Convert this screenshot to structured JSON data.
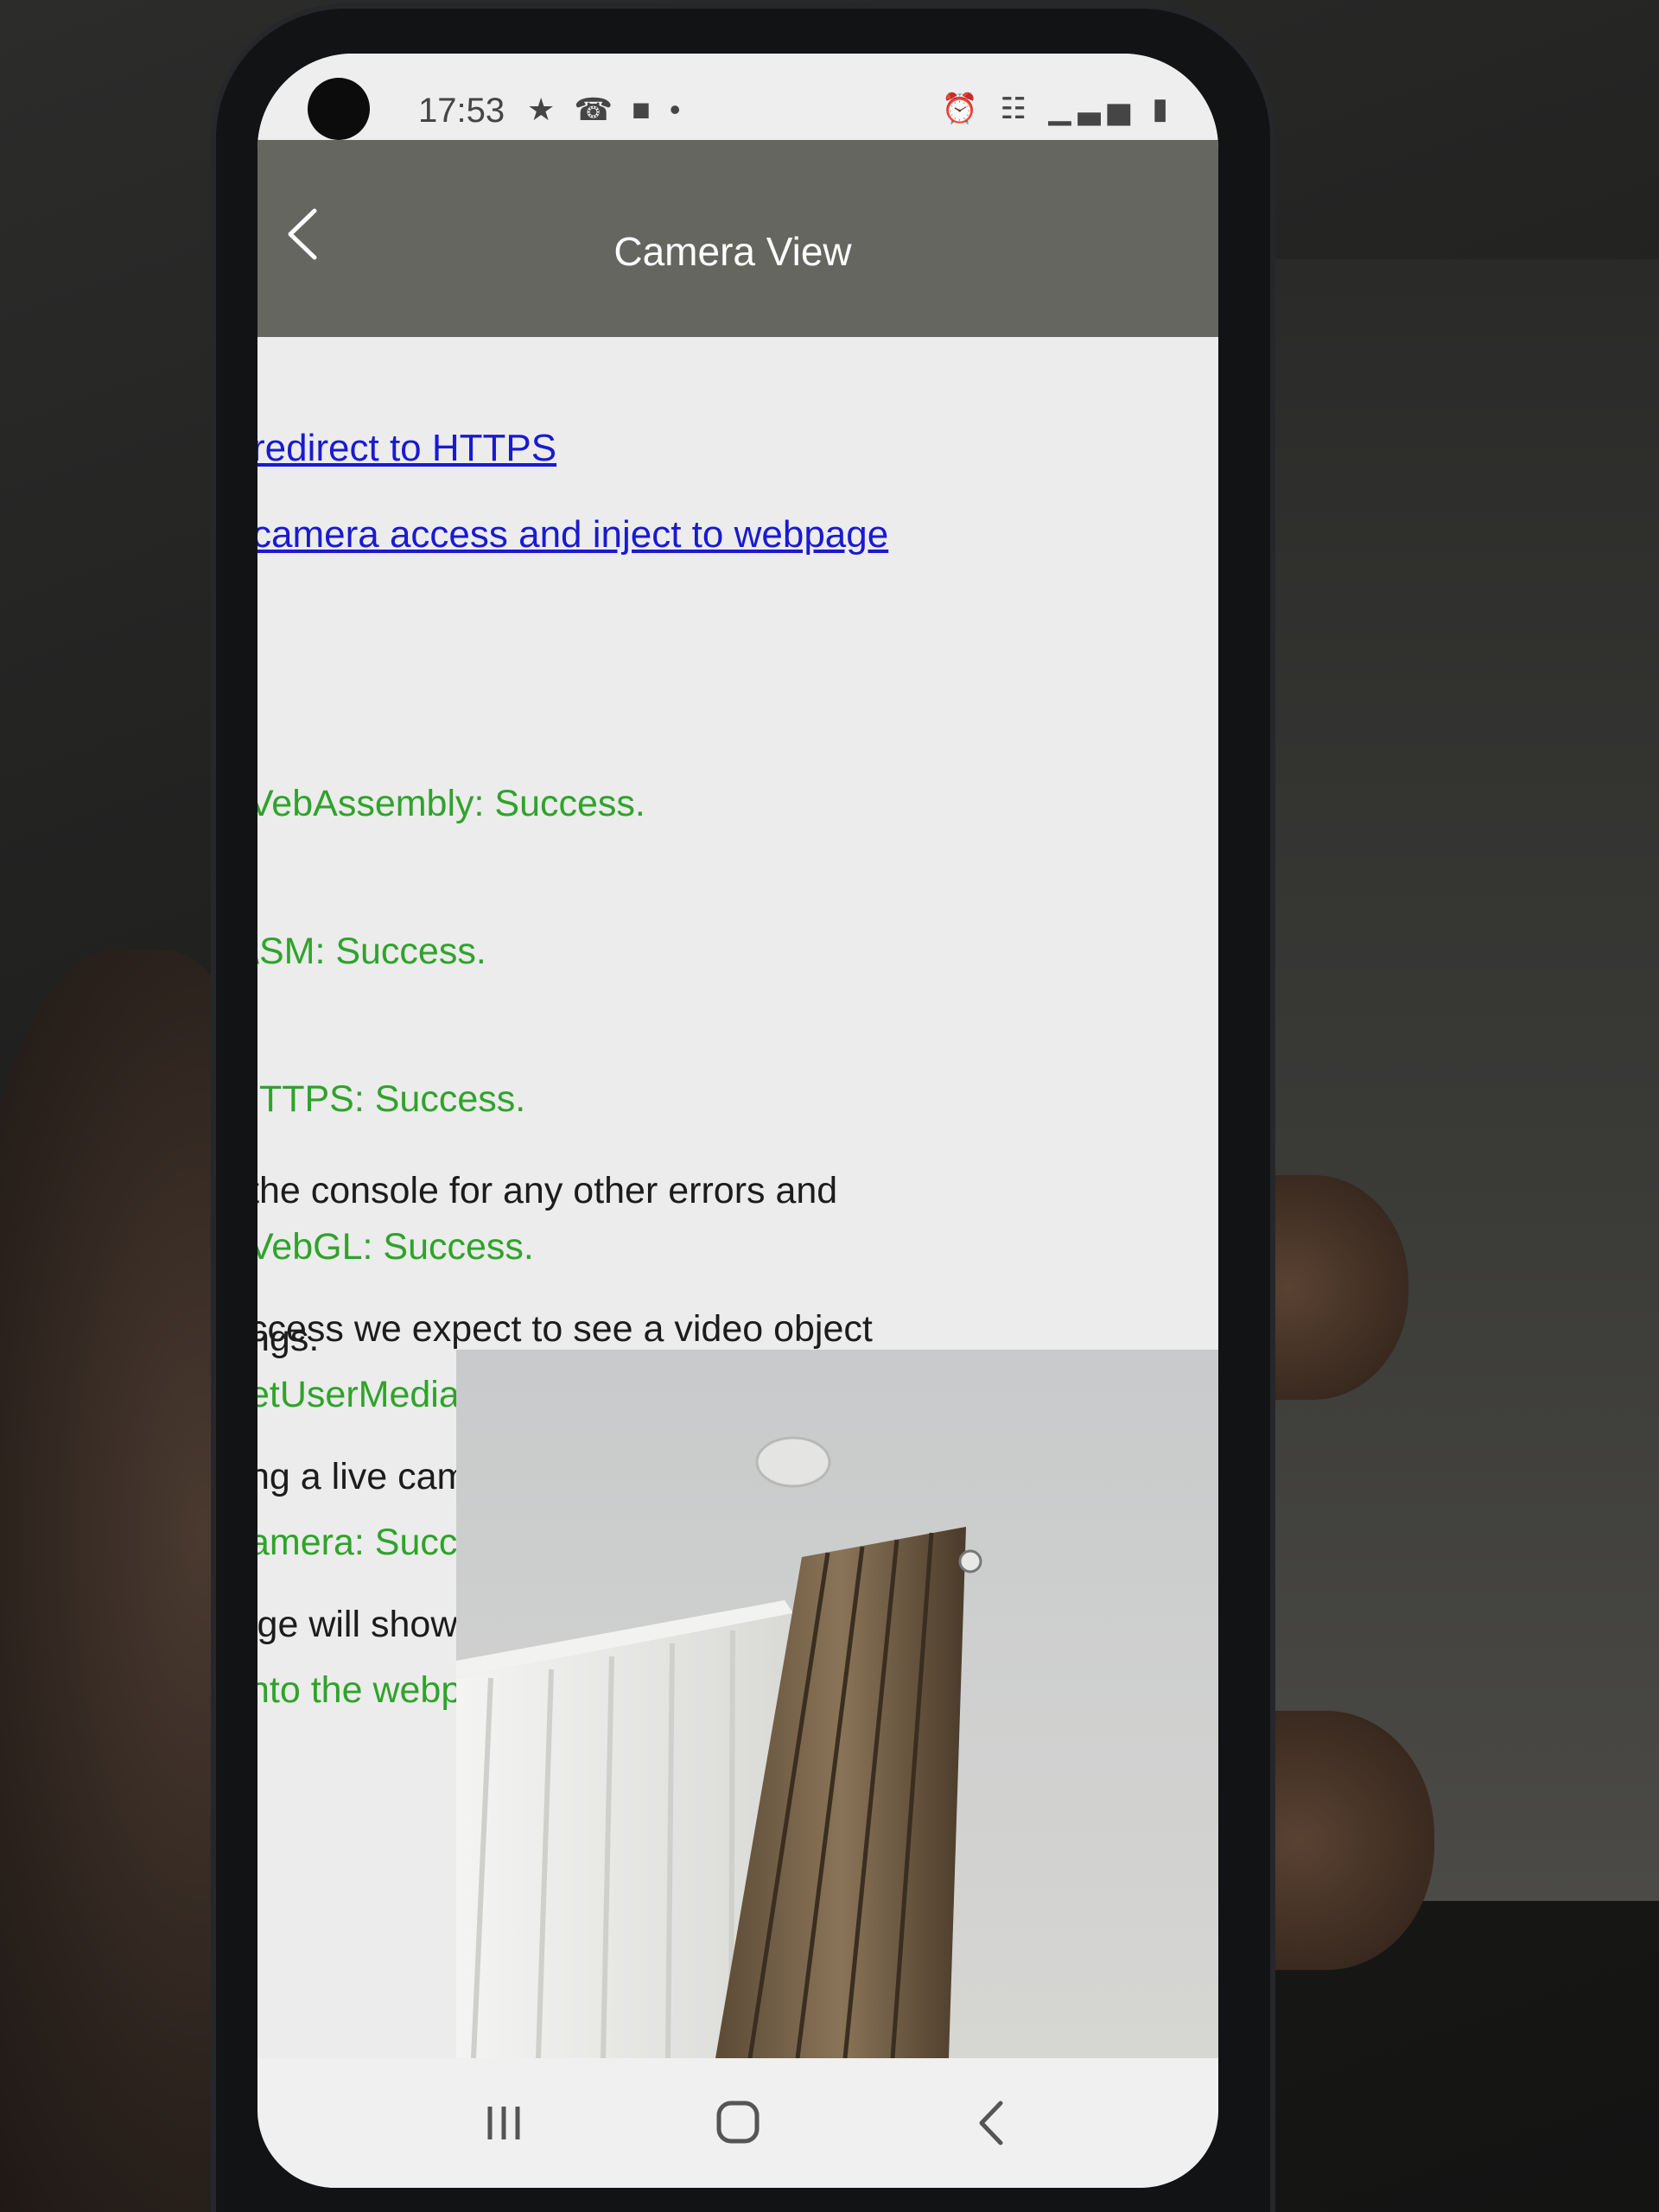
{
  "status_bar": {
    "time": "17:53",
    "left_icons": "★ ☎ ■ •",
    "right_icons": "⏰ ☷ ▁▃▅ ▮"
  },
  "app_bar": {
    "title": "Camera View",
    "back_icon": "chevron-left-icon"
  },
  "links": [
    {
      "text": "redirect to HTTPS"
    },
    {
      "text": "camera access and inject to webpage"
    }
  ],
  "status_lines": [
    "VebAssembly: Success.",
    "\\SM: Success.",
    "ITTPS: Success.",
    "VebGL: Success.",
    "etUserMedia: Success.",
    "amera: Success, was found and injected",
    "nto the webpage"
  ],
  "paragraphs": [
    {
      "lines": [
        "the console for any other errors and",
        "ngs."
      ]
    },
    {
      "lines": [
        "ccess we expect to see a video object",
        "ng a live camera feed, otherwise an error",
        "ige will show."
      ]
    }
  ],
  "video": {
    "name": "live-camera-feed"
  },
  "nav_bar": {
    "recents_icon": "recents-icon",
    "home_icon": "home-icon",
    "back_icon": "back-icon"
  },
  "colors": {
    "app_bar": "#666660",
    "link": "#1a1ad0",
    "success": "#2fa32a",
    "text": "#1c1c1c"
  }
}
